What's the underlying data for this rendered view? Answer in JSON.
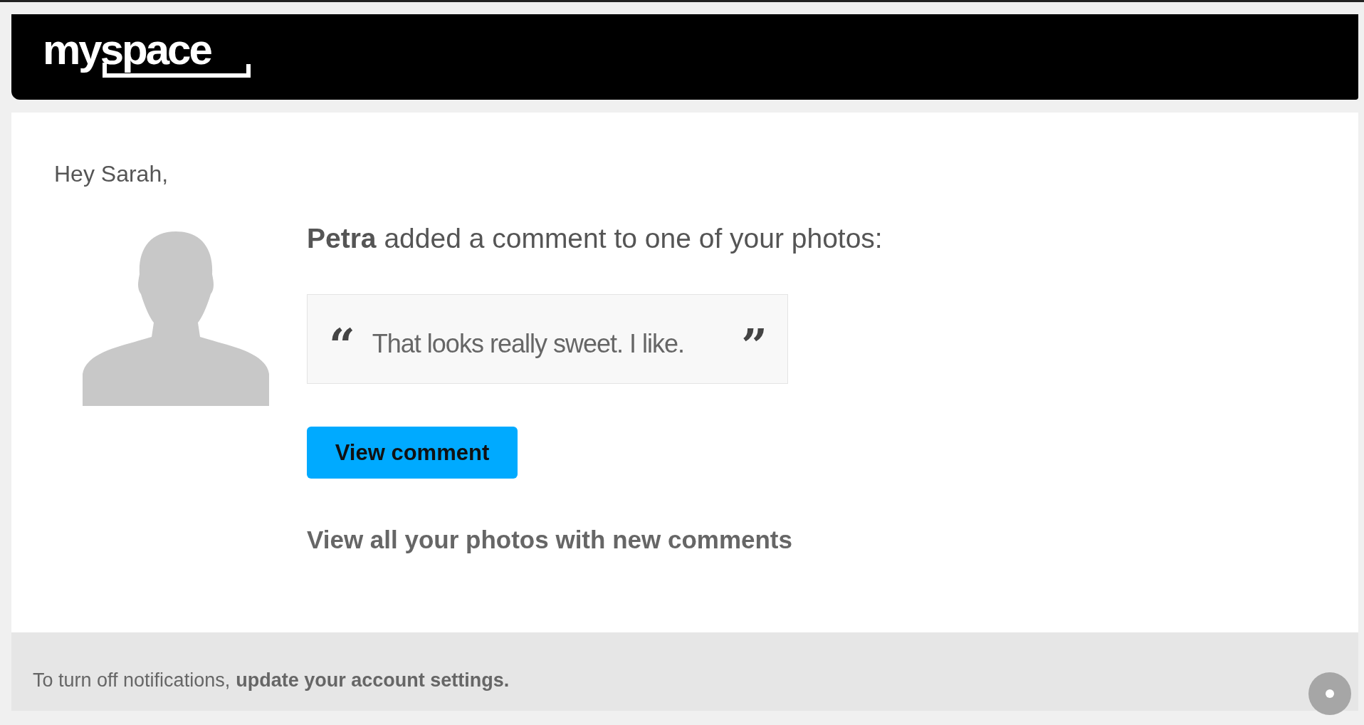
{
  "header": {
    "logo": "myspace"
  },
  "email": {
    "greeting": "Hey Sarah,",
    "message": "**Petra** added a comment to one of your photos:",
    "quote": {
      "open_mark": "“",
      "text": "That looks really sweet. I like.",
      "close_mark": "”"
    },
    "button": "View comment",
    "link": "View all your photos with new comments"
  },
  "footer": {
    "text": "To turn off notifications,",
    "link": "update your account settings."
  }
}
